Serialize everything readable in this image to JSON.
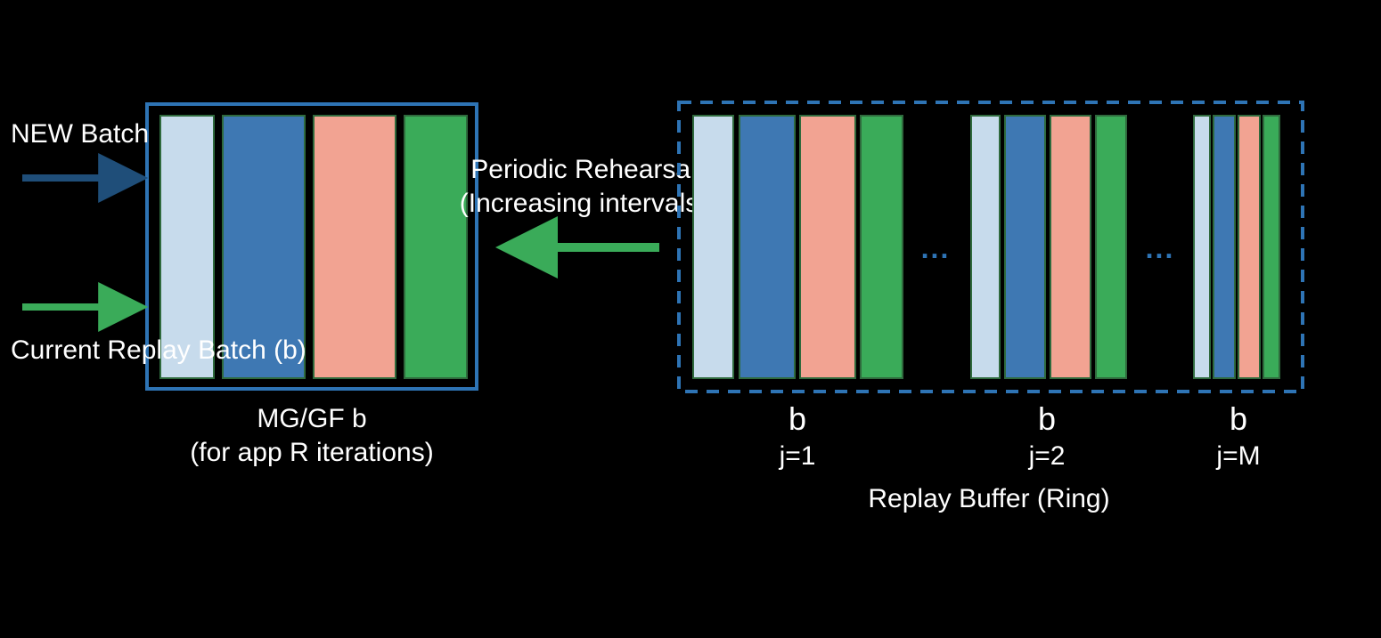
{
  "colors": {
    "lightblue": "#C7DBEC",
    "blue": "#3E78B3",
    "salmon": "#F2A392",
    "green": "#3AAB59",
    "boxBorder": "#2E74B5",
    "darkArrow": "#1F4E79",
    "greenArrow": "#3AAB59",
    "barStroke": "#2F6A3D"
  },
  "left": {
    "label_line1": "MG/GF b",
    "label_line2": "(for app R iterations)",
    "arrow_new_label": "NEW Batch",
    "arrow_cur_label": "Current Replay Batch (b)"
  },
  "middle": {
    "arrow_label_line1": "Periodic Rehearsal",
    "arrow_label_line2": "(Increasing intervals)"
  },
  "right": {
    "box_label": "Replay Buffer (Ring)",
    "group_labels": {
      "a": "b",
      "b": "b",
      "c": "b"
    },
    "index_labels": {
      "a": "j=1",
      "b": "j=2",
      "c": "j=M"
    },
    "ellipsis": "..."
  }
}
